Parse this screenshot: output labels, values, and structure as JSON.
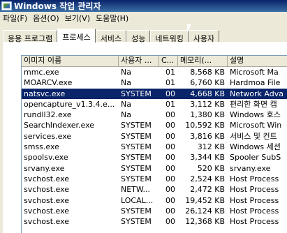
{
  "title": "Windows 작업 관리자",
  "menu": [
    "파일(F)",
    "옵션(O)",
    "보기(V)",
    "도움말(H)"
  ],
  "tabs": [
    "응용 프로그램",
    "프로세스",
    "서비스",
    "성능",
    "네트워킹",
    "사용자"
  ],
  "columns": [
    "이미지 이름",
    "사용자 ...",
    "C...",
    "메모리(...",
    "설명"
  ],
  "rows": [
    {
      "name": "mmc.exe",
      "user": "Na",
      "cpu": "01",
      "mem": "8,568 KB",
      "desc": "Microsoft Ma"
    },
    {
      "name": "MOARCV.exe",
      "user": "Na",
      "cpu": "01",
      "mem": "6,760 KB",
      "desc": "Hardmoa File"
    },
    {
      "name": "natsvc.exe",
      "user": "SYSTEM",
      "cpu": "00",
      "mem": "4,668 KB",
      "desc": "Network Adva"
    },
    {
      "name": "opencapture_v1.3.4.e...",
      "user": "Na",
      "cpu": "01",
      "mem": "3,112 KB",
      "desc": "편리한 화면 캡"
    },
    {
      "name": "rundll32.exe",
      "user": "Na",
      "cpu": "00",
      "mem": "1,380 KB",
      "desc": "Windows 호스"
    },
    {
      "name": "SearchIndexer.exe",
      "user": "SYSTEM",
      "cpu": "00",
      "mem": "10,592 KB",
      "desc": "Microsoft Win"
    },
    {
      "name": "services.exe",
      "user": "SYSTEM",
      "cpu": "00",
      "mem": "3,816 KB",
      "desc": "서비스 및 컨트"
    },
    {
      "name": "smss.exe",
      "user": "SYSTEM",
      "cpu": "00",
      "mem": "312 KB",
      "desc": "Windows 세션"
    },
    {
      "name": "spoolsv.exe",
      "user": "SYSTEM",
      "cpu": "00",
      "mem": "3,344 KB",
      "desc": "Spooler SubS"
    },
    {
      "name": "srvany.exe",
      "user": "SYSTEM",
      "cpu": "00",
      "mem": "520 KB",
      "desc": "srvany.exe"
    },
    {
      "name": "svchost.exe",
      "user": "SYSTEM",
      "cpu": "00",
      "mem": "2,524 KB",
      "desc": "Host Process"
    },
    {
      "name": "svchost.exe",
      "user": "NETW...",
      "cpu": "00",
      "mem": "2,472 KB",
      "desc": "Host Process"
    },
    {
      "name": "svchost.exe",
      "user": "LOCAL...",
      "cpu": "00",
      "mem": "19,452 KB",
      "desc": "Host Process"
    },
    {
      "name": "svchost.exe",
      "user": "SYSTEM",
      "cpu": "00",
      "mem": "26,124 KB",
      "desc": "Host Process"
    },
    {
      "name": "svchost.exe",
      "user": "SYSTEM",
      "cpu": "00",
      "mem": "12,368 KB",
      "desc": "Host Process"
    }
  ],
  "selected_row": 2
}
